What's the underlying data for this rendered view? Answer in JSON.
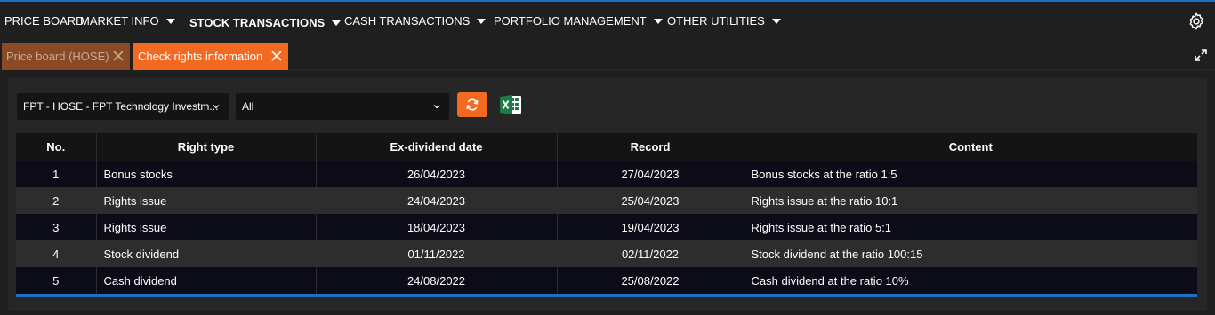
{
  "nav": {
    "items": [
      {
        "label": "PRICE BOARD",
        "has_caret": false,
        "bold": false
      },
      {
        "label": "MARKET INFO",
        "has_caret": true,
        "bold": false
      },
      {
        "label": "STOCK TRANSACTIONS",
        "has_caret": true,
        "bold": true
      },
      {
        "label": "CASH TRANSACTIONS",
        "has_caret": true,
        "bold": false
      },
      {
        "label": "PORTFOLIO MANAGEMENT",
        "has_caret": true,
        "bold": false
      },
      {
        "label": "OTHER UTILITIES",
        "has_caret": true,
        "bold": false
      }
    ],
    "settings_icon": "gear-icon"
  },
  "tabs": {
    "inactive_label": "Price board (HOSE)",
    "active_label": "Check rights information"
  },
  "filters": {
    "stock_select": "FPT - HOSE - FPT Technology Investm...",
    "type_select": "All"
  },
  "colors": {
    "accent": "#f26a21",
    "highlight": "#1f6fc4",
    "excel": "#1e7b45"
  },
  "table": {
    "headers": [
      "No.",
      "Right type",
      "Ex-dividend date",
      "Record",
      "Content"
    ],
    "rows": [
      [
        "1",
        "Bonus stocks",
        "26/04/2023",
        "27/04/2023",
        "Bonus stocks at the ratio 1:5"
      ],
      [
        "2",
        "Rights issue",
        "24/04/2023",
        "25/04/2023",
        "Rights issue at the ratio 10:1"
      ],
      [
        "3",
        "Rights issue",
        "18/04/2023",
        "19/04/2023",
        "Rights issue at the ratio 5:1"
      ],
      [
        "4",
        "Stock dividend",
        "01/11/2022",
        "02/11/2022",
        "Stock dividend at the ratio 100:15"
      ],
      [
        "5",
        "Cash dividend",
        "24/08/2022",
        "25/08/2022",
        "Cash dividend at the ratio 10%"
      ]
    ]
  }
}
